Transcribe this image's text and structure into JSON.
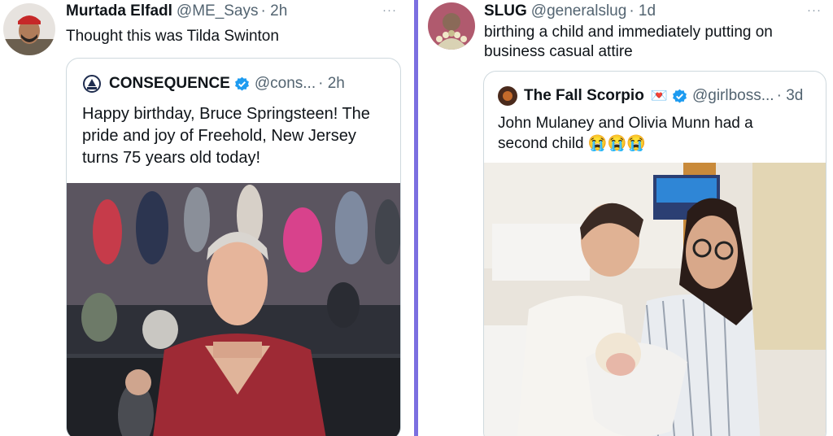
{
  "left_tweet": {
    "display_name": "Murtada Elfadl",
    "handle": "@ME_Says",
    "time": "· 2h",
    "text": "Thought this was Tilda Swinton",
    "more_icon": "···",
    "quote": {
      "display_name": "CONSEQUENCE",
      "handle": "@cons...",
      "time": "· 2h",
      "text": "Happy birthday, Bruce Springsteen! The pride and joy of Freehold, New Jersey turns 75 years old today!"
    }
  },
  "right_tweet": {
    "display_name": "SLUG",
    "handle": "@generalslug",
    "time": "· 1d",
    "text": "birthing a child and immediately putting on business casual attire",
    "more_icon": "···",
    "quote": {
      "display_name": "The Fall Scorpio",
      "badge_emoji": "💌",
      "handle": "@girlboss...",
      "time": "· 3d",
      "text": "John Mulaney and Olivia Munn had a second child",
      "emojis": "😭😭😭"
    }
  },
  "colors": {
    "divider": "#7b6fe0",
    "verified_blue": "#1d9bf0",
    "secondary_text": "#536471"
  }
}
